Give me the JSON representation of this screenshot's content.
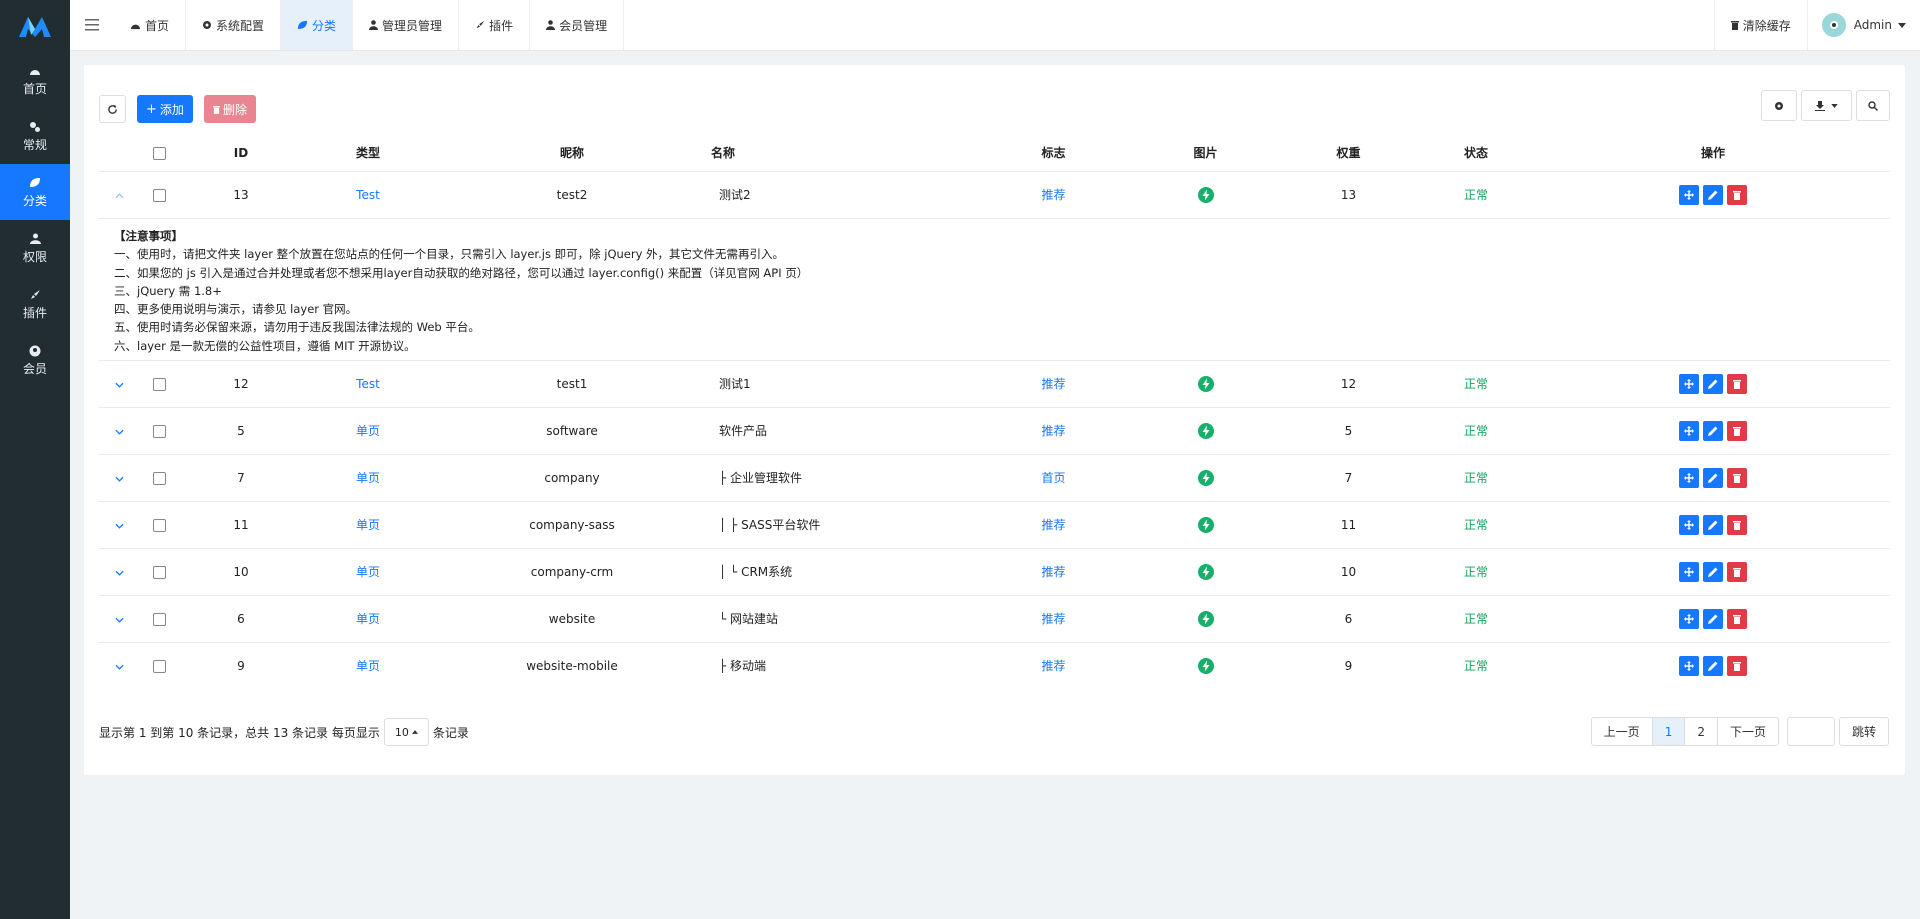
{
  "sidebar": {
    "items": [
      {
        "label": "首页",
        "icon": "dashboard-icon"
      },
      {
        "label": "常规",
        "icon": "cogs-icon"
      },
      {
        "label": "分类",
        "icon": "leaf-icon"
      },
      {
        "label": "权限",
        "icon": "group-icon"
      },
      {
        "label": "插件",
        "icon": "rocket-icon"
      },
      {
        "label": "会员",
        "icon": "user-circle-icon"
      }
    ]
  },
  "topbar": {
    "tabs": [
      {
        "label": "首页",
        "icon": "dashboard-icon"
      },
      {
        "label": "系统配置",
        "icon": "gear-icon"
      },
      {
        "label": "分类",
        "icon": "leaf-icon"
      },
      {
        "label": "管理员管理",
        "icon": "user-icon"
      },
      {
        "label": "插件",
        "icon": "rocket-icon"
      },
      {
        "label": "会员管理",
        "icon": "user-icon"
      }
    ],
    "clear_cache": "清除缓存",
    "username": "Admin"
  },
  "toolbar": {
    "add_label": "添加",
    "delete_label": "删除"
  },
  "table": {
    "headers": {
      "id": "ID",
      "type": "类型",
      "nickname": "昵称",
      "name": "名称",
      "flag": "标志",
      "image": "图片",
      "weight": "权重",
      "status": "状态",
      "ops": "操作"
    },
    "rows": [
      {
        "id": "13",
        "type": "Test",
        "nickname": "test2",
        "name": "测试2",
        "flag": "推荐",
        "weight": "13",
        "status": "正常"
      },
      {
        "id": "12",
        "type": "Test",
        "nickname": "test1",
        "name": "测试1",
        "flag": "推荐",
        "weight": "12",
        "status": "正常"
      },
      {
        "id": "5",
        "type": "单页",
        "nickname": "software",
        "name": "软件产品",
        "flag": "推荐",
        "weight": "5",
        "status": "正常"
      },
      {
        "id": "7",
        "type": "单页",
        "nickname": "company",
        "name": "├ 企业管理软件",
        "flag": "首页",
        "weight": "7",
        "status": "正常"
      },
      {
        "id": "11",
        "type": "单页",
        "nickname": "company-sass",
        "name": "│ ├ SASS平台软件",
        "flag": "推荐",
        "weight": "11",
        "status": "正常"
      },
      {
        "id": "10",
        "type": "单页",
        "nickname": "company-crm",
        "name": "│ └ CRM系统",
        "flag": "推荐",
        "weight": "10",
        "status": "正常"
      },
      {
        "id": "6",
        "type": "单页",
        "nickname": "website",
        "name": "└ 网站建站",
        "flag": "推荐",
        "weight": "6",
        "status": "正常"
      },
      {
        "id": "9",
        "type": "单页",
        "nickname": "website-mobile",
        "name": "├ 移动端",
        "flag": "推荐",
        "weight": "9",
        "status": "正常"
      }
    ],
    "detail": {
      "title": "【注意事项】",
      "lines": [
        "一、使用时，请把文件夹 layer 整个放置在您站点的任何一个目录，只需引入 layer.js 即可，除 jQuery 外，其它文件无需再引入。",
        "二、如果您的 js 引入是通过合并处理或者您不想采用layer自动获取的绝对路径，您可以通过 layer.config() 来配置（详见官网 API 页）",
        "三、jQuery 需 1.8+",
        "四、更多使用说明与演示，请参见 layer 官网。",
        "五、使用时请务必保留来源，请勿用于违反我国法律法规的 Web 平台。",
        "六、layer 是一款无偿的公益性项目，遵循 MIT 开源协议。"
      ]
    }
  },
  "footer": {
    "info_prefix": "显示第 1 到第 10 条记录，总共 13 条记录 每页显示",
    "page_size": "10",
    "info_suffix": "条记录",
    "prev": "上一页",
    "pages": [
      "1",
      "2"
    ],
    "next": "下一页",
    "jump": "跳转"
  },
  "colors": {
    "accent": "#1677ff",
    "danger": "#e03b47",
    "success": "#12a35a",
    "sidebar_bg": "#222d32"
  }
}
